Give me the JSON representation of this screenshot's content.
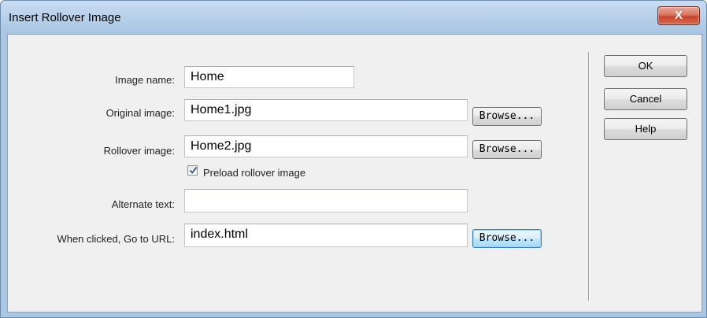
{
  "window": {
    "title": "Insert Rollover Image",
    "close_glyph": "X"
  },
  "form": {
    "image_name": {
      "label": "Image name:",
      "value": "Home"
    },
    "original_image": {
      "label": "Original image:",
      "value": "Home1.jpg",
      "browse_label": "Browse..."
    },
    "rollover_image": {
      "label": "Rollover image:",
      "value": "Home2.jpg",
      "browse_label": "Browse..."
    },
    "preload": {
      "label": "Preload rollover image",
      "checked": true
    },
    "alternate_text": {
      "label": "Alternate text:",
      "value": ""
    },
    "go_to_url": {
      "label": "When clicked, Go to URL:",
      "value": "index.html",
      "browse_label": "Browse..."
    }
  },
  "buttons": {
    "ok": "OK",
    "cancel": "Cancel",
    "help": "Help"
  },
  "colors": {
    "titlebar": "#b9d1ea",
    "client_bg": "#f0f0f0",
    "close_button": "#c7442c",
    "focused_button": "#bee6fd"
  }
}
